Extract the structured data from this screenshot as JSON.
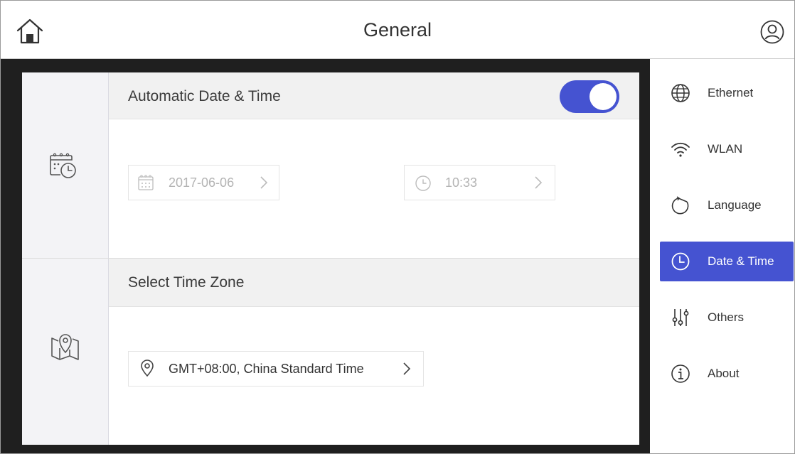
{
  "header": {
    "title": "General",
    "home_icon": "home-icon",
    "user_icon": "user-icon"
  },
  "colors": {
    "accent": "#4553d1",
    "dark_background": "#1f1f1f",
    "disabled_text": "#b4b4b4"
  },
  "date_time_section": {
    "icon": "calendar-clock-icon",
    "title": "Automatic Date & Time",
    "auto_enabled": true,
    "date": {
      "icon": "calendar-icon",
      "value": "2017-06-06"
    },
    "time": {
      "icon": "clock-icon",
      "value": "10:33"
    }
  },
  "time_zone_section": {
    "icon": "map-pin-icon",
    "title": "Select Time Zone",
    "zone": {
      "icon": "location-icon",
      "value": "GMT+08:00, China Standard Time"
    }
  },
  "sidebar": {
    "items": [
      {
        "label": "Ethernet",
        "icon": "globe-icon",
        "active": false
      },
      {
        "label": "WLAN",
        "icon": "wifi-icon",
        "active": false
      },
      {
        "label": "Language",
        "icon": "language-icon",
        "active": false
      },
      {
        "label": "Date & Time",
        "icon": "clock-icon",
        "active": true
      },
      {
        "label": "Others",
        "icon": "sliders-icon",
        "active": false
      },
      {
        "label": "About",
        "icon": "info-icon",
        "active": false
      }
    ]
  }
}
